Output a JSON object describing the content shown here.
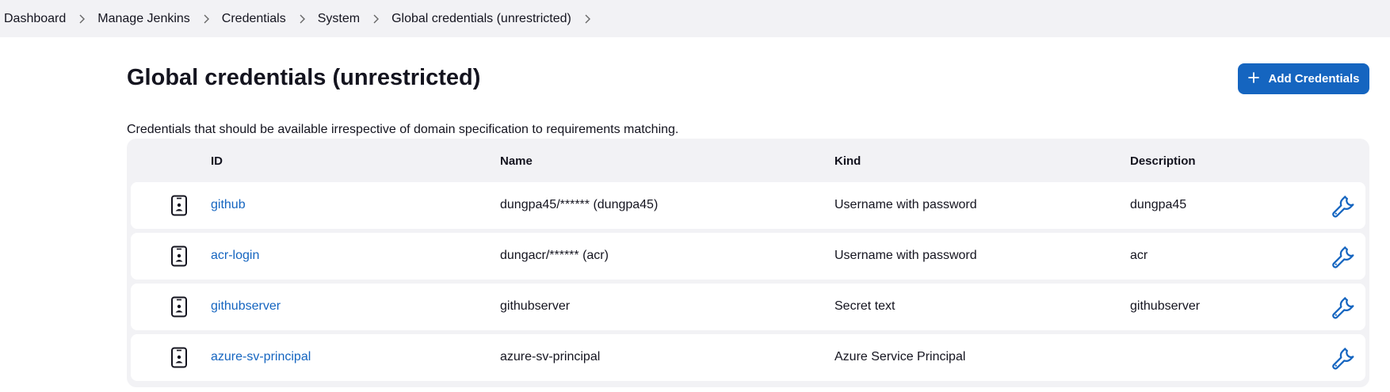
{
  "breadcrumb": [
    "Dashboard",
    "Manage Jenkins",
    "Credentials",
    "System",
    "Global credentials (unrestricted)"
  ],
  "page": {
    "title": "Global credentials (unrestricted)",
    "description": "Credentials that should be available irrespective of domain specification to requirements matching.",
    "add_button": "Add Credentials",
    "add_icon": "plus-icon"
  },
  "table": {
    "headers": {
      "id": "ID",
      "name": "Name",
      "kind": "Kind",
      "description": "Description"
    },
    "rows": [
      {
        "type_icon": "credential-phone-icon",
        "id": "github",
        "name": "dungpa45/****** (dungpa45)",
        "kind": "Username with password",
        "description": "dungpa45",
        "action_icon": "wrench-icon"
      },
      {
        "type_icon": "credential-phone-icon",
        "id": "acr-login",
        "name": "dungacr/****** (acr)",
        "kind": "Username with password",
        "description": "acr",
        "action_icon": "wrench-icon"
      },
      {
        "type_icon": "credential-phone-icon",
        "id": "githubserver",
        "name": "githubserver",
        "kind": "Secret text",
        "description": "githubserver",
        "action_icon": "wrench-icon"
      },
      {
        "type_icon": "credential-phone-icon",
        "id": "azure-sv-principal",
        "name": "azure-sv-principal",
        "kind": "Azure Service Principal",
        "description": "",
        "action_icon": "wrench-icon"
      }
    ]
  },
  "colors": {
    "accent": "#1565c0",
    "breadcrumb_bg": "#f2f2f5",
    "table_bg": "#f2f2f5",
    "text": "#14141f"
  }
}
